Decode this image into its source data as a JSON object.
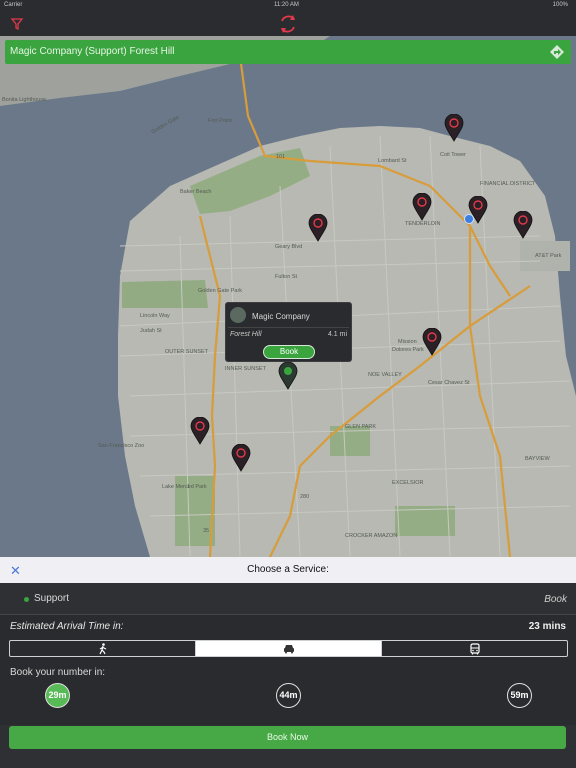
{
  "status_bar": {
    "carrier": "Carrier",
    "time": "11:20 AM",
    "battery": "100%"
  },
  "navbar": {
    "filter_icon": "filter-icon",
    "refresh_icon": "refresh-icon"
  },
  "search": {
    "text": "Magic Company (Support) Forest Hill",
    "directions_icon": "directions-icon"
  },
  "map_labels": [
    "Bonita Lighthouse",
    "Golden Gate",
    "Fort Point",
    "Baker Beach",
    "Coit Tower",
    "Lombard St",
    "FINANCIAL DISTRICT",
    "TENDERLOIN",
    "AT&T Park",
    "Geary Blvd",
    "Fulton St",
    "Golden Gate Park",
    "Lincoln Way",
    "Judah St",
    "OUTER SUNSET",
    "INNER SUNSET",
    "Mission",
    "Dolores Park",
    "NOE VALLEY",
    "Cesar Chavez St",
    "GLEN PARK",
    "San Francisco Zoo",
    "Lake Merced Park",
    "EXCELSIOR",
    "BAYVIEW",
    "CROCKER AMAZON",
    "101",
    "280",
    "1",
    "35"
  ],
  "callout": {
    "name": "Magic Company",
    "location": "Forest Hill",
    "distance": "4.1 mi",
    "book_label": "Book"
  },
  "sheet": {
    "title": "Choose a Service:",
    "close_label": "✕",
    "service": {
      "name": "Support",
      "book_label": "Book"
    },
    "eta_label": "Estimated Arrival Time in:",
    "eta_value": "23 mins",
    "transport_modes": [
      "walk",
      "car",
      "bus"
    ],
    "selected_mode": "car",
    "book_in_label": "Book your number in:",
    "time_options": [
      "29m",
      "44m",
      "59m"
    ],
    "selected_time": "29m",
    "book_now_label": "Book Now"
  },
  "colors": {
    "accent_green": "#3aa53f",
    "pin_dark": "#2a2025",
    "pin_red": "#e23a4a"
  }
}
